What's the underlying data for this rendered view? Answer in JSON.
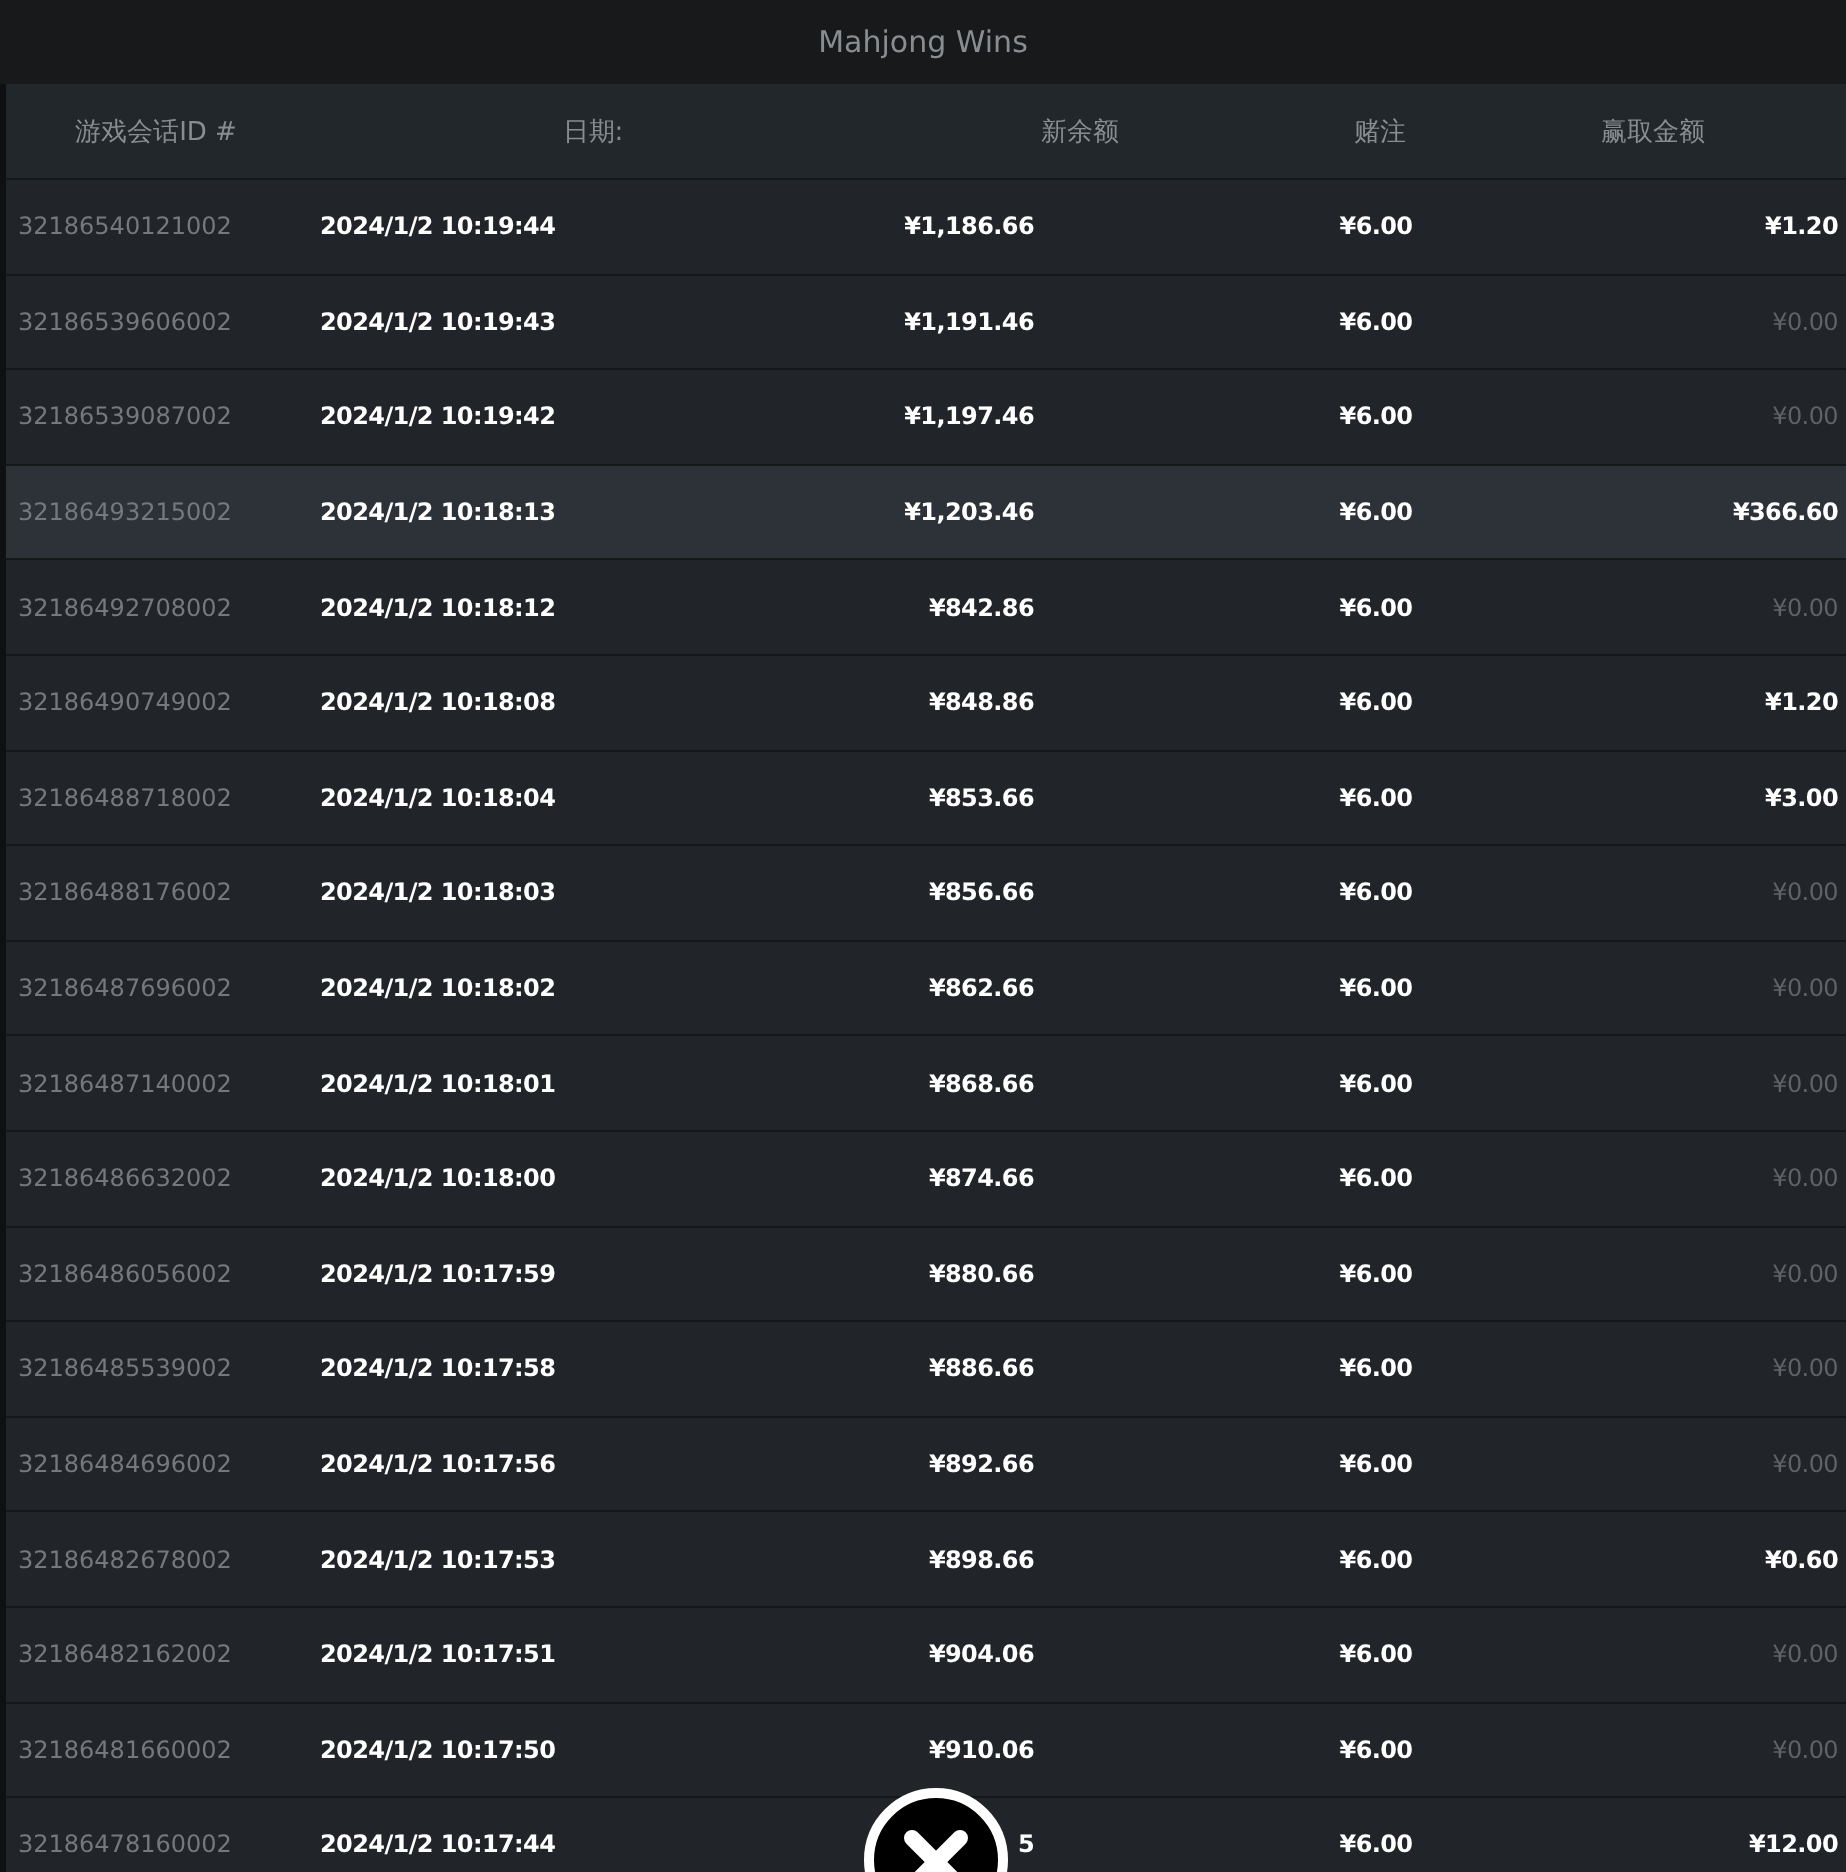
{
  "title": "Mahjong Wins",
  "columns": [
    "游戏会话ID #",
    "日期:",
    "新余额",
    "赌注",
    "赢取金额"
  ],
  "rows": [
    {
      "id": "32186540121002",
      "date": "2024/1/2 10:19:44",
      "balance": "¥1,186.66",
      "bet": "¥6.00",
      "win": "¥1.20",
      "muted": false,
      "highlighted": false
    },
    {
      "id": "32186539606002",
      "date": "2024/1/2 10:19:43",
      "balance": "¥1,191.46",
      "bet": "¥6.00",
      "win": "¥0.00",
      "muted": true,
      "highlighted": false
    },
    {
      "id": "32186539087002",
      "date": "2024/1/2 10:19:42",
      "balance": "¥1,197.46",
      "bet": "¥6.00",
      "win": "¥0.00",
      "muted": true,
      "highlighted": false
    },
    {
      "id": "32186493215002",
      "date": "2024/1/2 10:18:13",
      "balance": "¥1,203.46",
      "bet": "¥6.00",
      "win": "¥366.60",
      "muted": false,
      "highlighted": true
    },
    {
      "id": "32186492708002",
      "date": "2024/1/2 10:18:12",
      "balance": "¥842.86",
      "bet": "¥6.00",
      "win": "¥0.00",
      "muted": true,
      "highlighted": false
    },
    {
      "id": "32186490749002",
      "date": "2024/1/2 10:18:08",
      "balance": "¥848.86",
      "bet": "¥6.00",
      "win": "¥1.20",
      "muted": false,
      "highlighted": false
    },
    {
      "id": "32186488718002",
      "date": "2024/1/2 10:18:04",
      "balance": "¥853.66",
      "bet": "¥6.00",
      "win": "¥3.00",
      "muted": false,
      "highlighted": false
    },
    {
      "id": "32186488176002",
      "date": "2024/1/2 10:18:03",
      "balance": "¥856.66",
      "bet": "¥6.00",
      "win": "¥0.00",
      "muted": true,
      "highlighted": false
    },
    {
      "id": "32186487696002",
      "date": "2024/1/2 10:18:02",
      "balance": "¥862.66",
      "bet": "¥6.00",
      "win": "¥0.00",
      "muted": true,
      "highlighted": false
    },
    {
      "id": "32186487140002",
      "date": "2024/1/2 10:18:01",
      "balance": "¥868.66",
      "bet": "¥6.00",
      "win": "¥0.00",
      "muted": true,
      "highlighted": false
    },
    {
      "id": "32186486632002",
      "date": "2024/1/2 10:18:00",
      "balance": "¥874.66",
      "bet": "¥6.00",
      "win": "¥0.00",
      "muted": true,
      "highlighted": false
    },
    {
      "id": "32186486056002",
      "date": "2024/1/2 10:17:59",
      "balance": "¥880.66",
      "bet": "¥6.00",
      "win": "¥0.00",
      "muted": true,
      "highlighted": false
    },
    {
      "id": "32186485539002",
      "date": "2024/1/2 10:17:58",
      "balance": "¥886.66",
      "bet": "¥6.00",
      "win": "¥0.00",
      "muted": true,
      "highlighted": false
    },
    {
      "id": "32186484696002",
      "date": "2024/1/2 10:17:56",
      "balance": "¥892.66",
      "bet": "¥6.00",
      "win": "¥0.00",
      "muted": true,
      "highlighted": false
    },
    {
      "id": "32186482678002",
      "date": "2024/1/2 10:17:53",
      "balance": "¥898.66",
      "bet": "¥6.00",
      "win": "¥0.60",
      "muted": false,
      "highlighted": false
    },
    {
      "id": "32186482162002",
      "date": "2024/1/2 10:17:51",
      "balance": "¥904.06",
      "bet": "¥6.00",
      "win": "¥0.00",
      "muted": true,
      "highlighted": false
    },
    {
      "id": "32186481660002",
      "date": "2024/1/2 10:17:50",
      "balance": "¥910.06",
      "bet": "¥6.00",
      "win": "¥0.00",
      "muted": true,
      "highlighted": false
    },
    {
      "id": "32186478160002",
      "date": "2024/1/2 10:17:44",
      "balance": "5",
      "bet": "¥6.00",
      "win": "¥12.00",
      "muted": false,
      "highlighted": false
    }
  ]
}
